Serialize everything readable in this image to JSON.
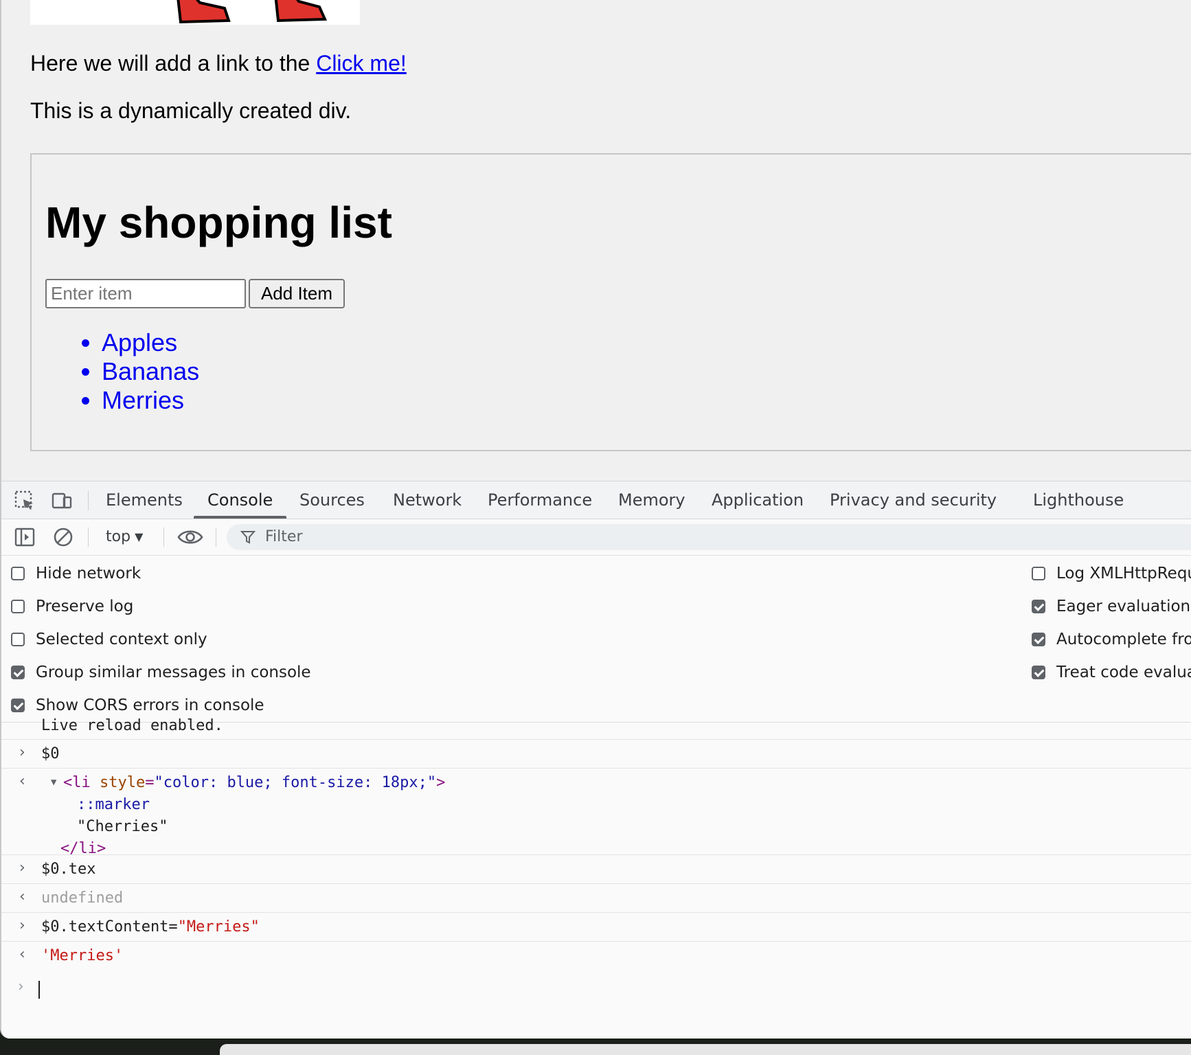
{
  "page": {
    "paragraph1_text": "Here we will add a link to the",
    "paragraph1_link": "Click me!",
    "paragraph2": "This is a dynamically created div.",
    "shopping": {
      "title": "My shopping list",
      "input_placeholder": "Enter item",
      "add_button": "Add Item",
      "items": [
        "Apples",
        "Bananas",
        "Merries"
      ]
    }
  },
  "devtools": {
    "tabs": [
      "Elements",
      "Console",
      "Sources",
      "Network",
      "Performance",
      "Memory",
      "Application",
      "Privacy and security",
      "Lighthouse"
    ],
    "active_tab": "Console",
    "toolbar": {
      "context": "top",
      "filter_placeholder": "Filter"
    },
    "settings_left": [
      {
        "label": "Hide network",
        "checked": false
      },
      {
        "label": "Preserve log",
        "checked": false
      },
      {
        "label": "Selected context only",
        "checked": false
      },
      {
        "label": "Group similar messages in console",
        "checked": true
      },
      {
        "label": "Show CORS errors in console",
        "checked": true
      }
    ],
    "settings_right": [
      {
        "label": "Log XMLHttpRequ",
        "checked": false
      },
      {
        "label": "Eager evaluation",
        "checked": true
      },
      {
        "label": "Autocomplete fro",
        "checked": true
      },
      {
        "label": "Treat code evalua",
        "checked": true
      }
    ],
    "console": {
      "log_live_reload": "Live reload enabled.",
      "input1": "$0",
      "out1_tag_open": "<li",
      "out1_attr_name": "style",
      "out1_attr_value": "\"color: blue; font-size: 18px;\"",
      "out1_tag_close": ">",
      "out1_marker": "::marker",
      "out1_text": "\"Cherries\"",
      "out1_end_tag": "</li>",
      "input2": "$0.tex",
      "out2": "undefined",
      "input3_prefix": "$0.textContent=",
      "input3_string": "\"Merries\"",
      "out3": "'Merries'"
    }
  },
  "colors": {
    "link": "#0000ee",
    "list_item": "#0000ee",
    "string": "#c41a16",
    "tag": "#881280"
  }
}
